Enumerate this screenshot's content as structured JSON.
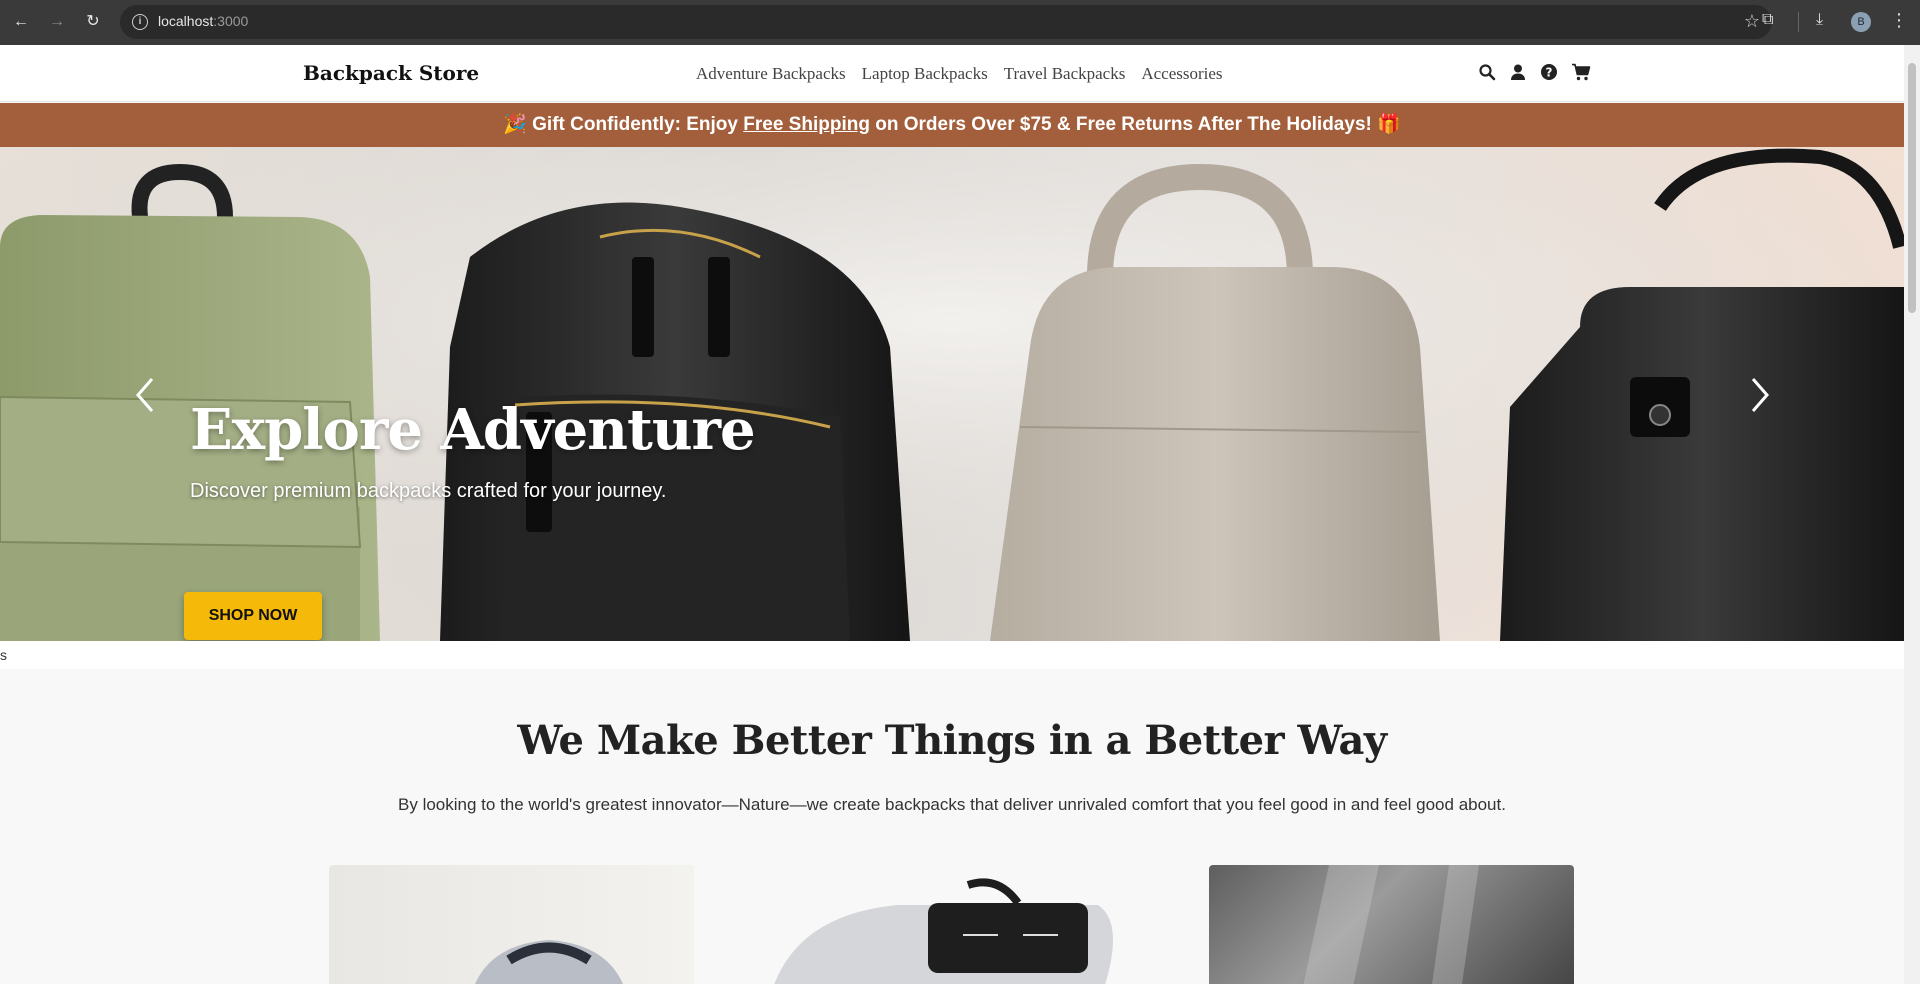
{
  "browser": {
    "url_host": "localhost",
    "url_port": ":3000",
    "profile_initial": "B"
  },
  "header": {
    "brand": "Backpack Store",
    "nav": [
      "Adventure Backpacks",
      "Laptop Backpacks",
      "Travel Backpacks",
      "Accessories"
    ],
    "icons": [
      "search-icon",
      "user-icon",
      "help-icon",
      "cart-icon"
    ]
  },
  "promo": {
    "emoji_left": "🎉",
    "text_before": "Gift Confidently: Enjoy ",
    "link": "Free Shipping",
    "text_after": " on Orders Over $75 & Free Returns After The Holidays! ",
    "emoji_right": "🎁",
    "color": "#a35f3b"
  },
  "hero": {
    "title": "Explore Adventure",
    "subtitle": "Discover premium backpacks crafted for your journey.",
    "cta": "SHOP NOW",
    "cta_color": "#f5b90a"
  },
  "stray_text": "s",
  "section": {
    "title": "We Make Better Things in a Better Way",
    "lede": "By looking to the world's greatest innovator—Nature—we create backpacks that deliver unrivaled comfort that you feel good in and feel good about."
  }
}
